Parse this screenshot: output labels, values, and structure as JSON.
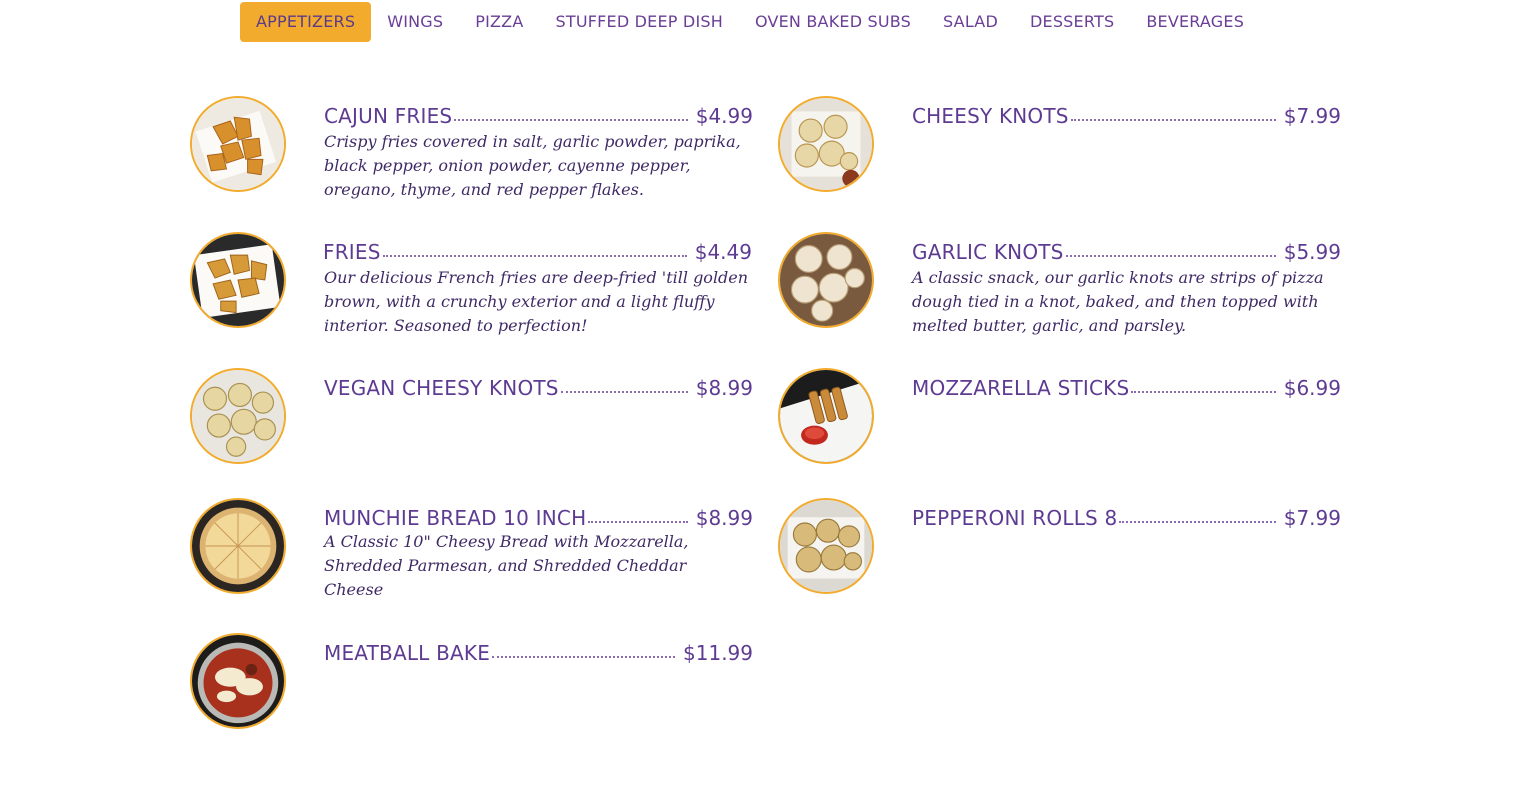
{
  "tabs": [
    {
      "label": "APPETIZERS",
      "active": true
    },
    {
      "label": "WINGS"
    },
    {
      "label": "PIZZA"
    },
    {
      "label": "STUFFED DEEP DISH"
    },
    {
      "label": "OVEN BAKED SUBS"
    },
    {
      "label": "SALAD"
    },
    {
      "label": "DESSERTS"
    },
    {
      "label": "BEVERAGES"
    }
  ],
  "items": [
    {
      "name": "CAJUN FRIES",
      "price": "$4.99",
      "description": "Crispy fries covered in salt, garlic powder, paprika, black pepper, onion powder, cayenne pepper, oregano, thyme, and red pepper flakes.",
      "image": "waffle-fries-photo"
    },
    {
      "name": "CHEESY KNOTS",
      "price": "$7.99",
      "description": "",
      "image": "cheesy-knots-photo"
    },
    {
      "name": "FRIES",
      "price": "$4.49",
      "description": "Our delicious French fries are deep-fried 'till golden brown, with a crunchy exterior and a light fluffy interior. Seasoned to perfection!",
      "image": "waffle-fries-photo"
    },
    {
      "name": "GARLIC KNOTS",
      "price": "$5.99",
      "description": "A classic snack, our garlic knots are strips of pizza dough tied in a knot, baked, and then topped with melted butter, garlic, and parsley.",
      "image": "garlic-knots-photo"
    },
    {
      "name": "VEGAN CHEESY KNOTS",
      "price": "$8.99",
      "description": "",
      "image": "vegan-knots-photo"
    },
    {
      "name": "MOZZARELLA STICKS",
      "price": "$6.99",
      "description": "",
      "image": "mozzarella-sticks-photo"
    },
    {
      "name": "MUNCHIE BREAD 10 INCH",
      "price": "$8.99",
      "description": "A Classic 10\" Cheesy Bread with Mozzarella, Shredded Parmesan, and Shredded Cheddar Cheese",
      "image": "cheese-bread-photo"
    },
    {
      "name": "PEPPERONI ROLLS 8",
      "price": "$7.99",
      "description": "",
      "image": "pepperoni-rolls-photo"
    },
    {
      "name": "MEATBALL BAKE",
      "price": "$11.99",
      "description": "",
      "image": "meatball-bake-photo"
    }
  ],
  "colors": {
    "accent": "#f2ab2c",
    "text": "#5e3b92"
  }
}
